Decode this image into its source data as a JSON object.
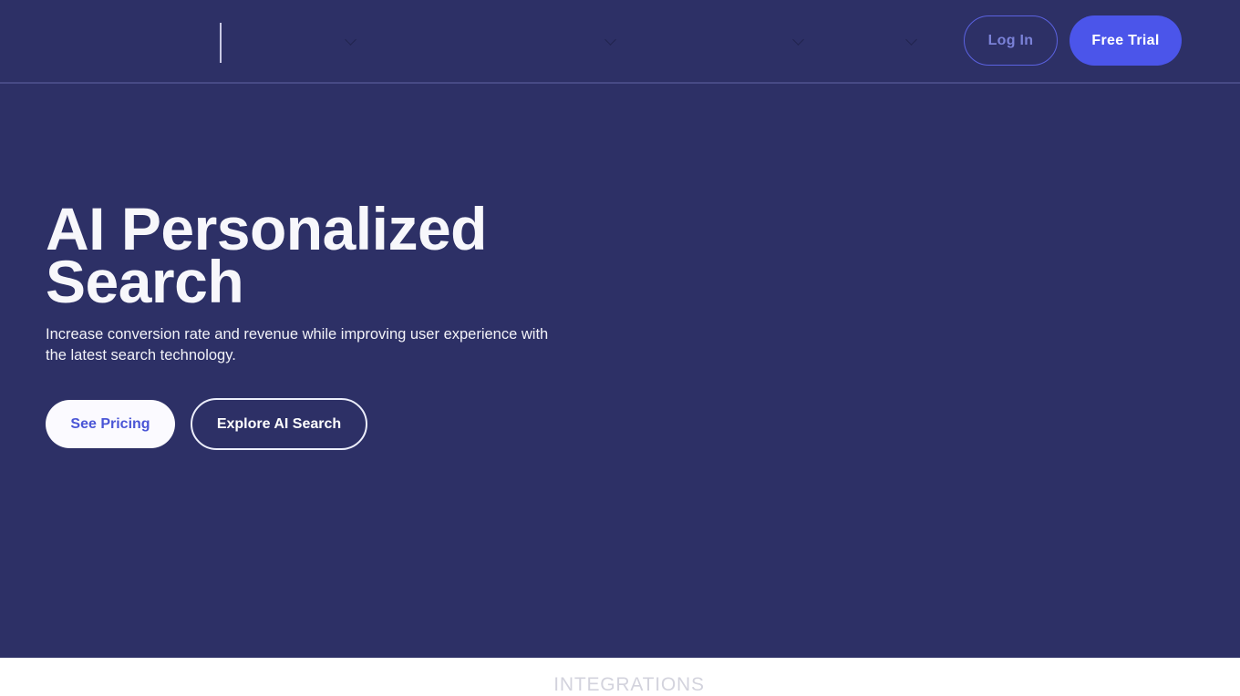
{
  "theme": {
    "hero_bg": "#2d3066",
    "header_bg": "#2d3066",
    "header_border": "#474a85",
    "accent_blue": "#4b55ea",
    "login_text": "#7b82d8",
    "pricing_text": "#4a55d6",
    "heading_text": "#f7f7fb",
    "integrations_text": "#d3d3dd",
    "page_bg": "#ffffff"
  },
  "header": {
    "brand": {
      "name": "logo-mark",
      "label": ""
    },
    "nav": [
      {
        "label": "",
        "icon": "chevron-down-icon",
        "has_dropdown": true
      },
      {
        "label": "",
        "icon": "chevron-down-icon",
        "has_dropdown": true
      },
      {
        "label": "",
        "icon": "chevron-down-icon",
        "has_dropdown": true
      },
      {
        "label": "",
        "icon": "chevron-down-icon",
        "has_dropdown": true
      }
    ],
    "login_label": "Log In",
    "free_trial_label": "Free Trial"
  },
  "hero": {
    "title": "AI Personalized Search",
    "subtitle": "Increase conversion rate and revenue while improving user experience with the latest search technology.",
    "primary_cta": "See Pricing",
    "secondary_cta": "Explore AI Search"
  },
  "integrations": {
    "label": "INTEGRATIONS"
  }
}
